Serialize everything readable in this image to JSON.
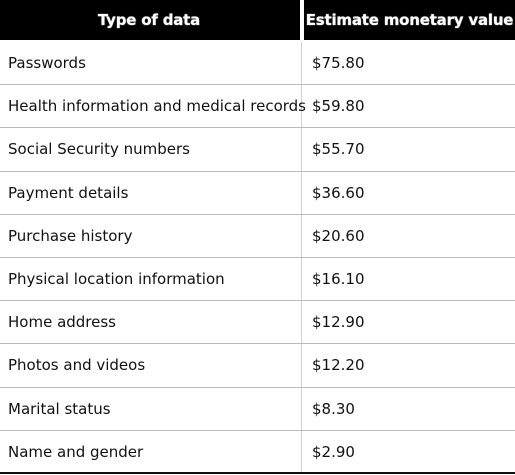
{
  "table": {
    "headers": {
      "type": "Type of data",
      "value": "Estimate monetary value"
    },
    "rows": [
      {
        "type": "Passwords",
        "value": "$75.80"
      },
      {
        "type": "Health information and medical records",
        "value": "$59.80"
      },
      {
        "type": "Social Security numbers",
        "value": "$55.70"
      },
      {
        "type": "Payment details",
        "value": "$36.60"
      },
      {
        "type": "Purchase history",
        "value": "$20.60"
      },
      {
        "type": "Physical location information",
        "value": "$16.10"
      },
      {
        "type": "Home address",
        "value": "$12.90"
      },
      {
        "type": "Photos and videos",
        "value": "$12.20"
      },
      {
        "type": "Marital status",
        "value": "$8.30"
      },
      {
        "type": "Name and gender",
        "value": "$2.90"
      }
    ]
  },
  "colors": {
    "header_bg": "#000000",
    "header_text": "#ffffff",
    "row_text": "#111111",
    "row_divider": "#bbbbbb"
  }
}
